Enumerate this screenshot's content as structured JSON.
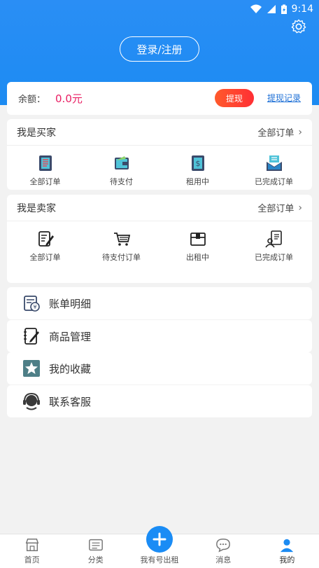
{
  "status_bar": {
    "time": "9:14"
  },
  "header": {
    "login_label": "登录/注册"
  },
  "balance": {
    "label": "余额：",
    "amount": "0.0元",
    "withdraw_label": "提现",
    "withdraw_log_label": "提现记录"
  },
  "buyer": {
    "title": "我是买家",
    "all_orders_label": "全部订单",
    "items": [
      {
        "label": "全部订单",
        "icon": "order-list-icon"
      },
      {
        "label": "待支付",
        "icon": "wallet-icon"
      },
      {
        "label": "租用中",
        "icon": "dollar-doc-icon"
      },
      {
        "label": "已完成订单",
        "icon": "inbox-icon"
      }
    ]
  },
  "seller": {
    "title": "我是卖家",
    "all_orders_label": "全部订单",
    "items": [
      {
        "label": "全部订单",
        "icon": "edit-doc-icon"
      },
      {
        "label": "待支付订单",
        "icon": "cart-icon"
      },
      {
        "label": "出租中",
        "icon": "box-icon"
      },
      {
        "label": "已完成订单",
        "icon": "user-doc-icon"
      }
    ]
  },
  "menu": [
    {
      "label": "账单明细",
      "icon": "bill-icon"
    },
    {
      "label": "商品管理",
      "icon": "notebook-icon"
    },
    {
      "label": "我的收藏",
      "icon": "star-icon"
    },
    {
      "label": "联系客服",
      "icon": "headset-icon"
    }
  ],
  "tabbar": [
    {
      "label": "首页",
      "icon": "home-icon"
    },
    {
      "label": "分类",
      "icon": "category-icon"
    },
    {
      "label": "我有号出租",
      "icon": "plus-icon"
    },
    {
      "label": "消息",
      "icon": "message-icon"
    },
    {
      "label": "我的",
      "icon": "profile-icon"
    }
  ],
  "colors": {
    "primary": "#1c8bf2",
    "amount": "#e91e63",
    "withdraw": "#ff3b30"
  }
}
